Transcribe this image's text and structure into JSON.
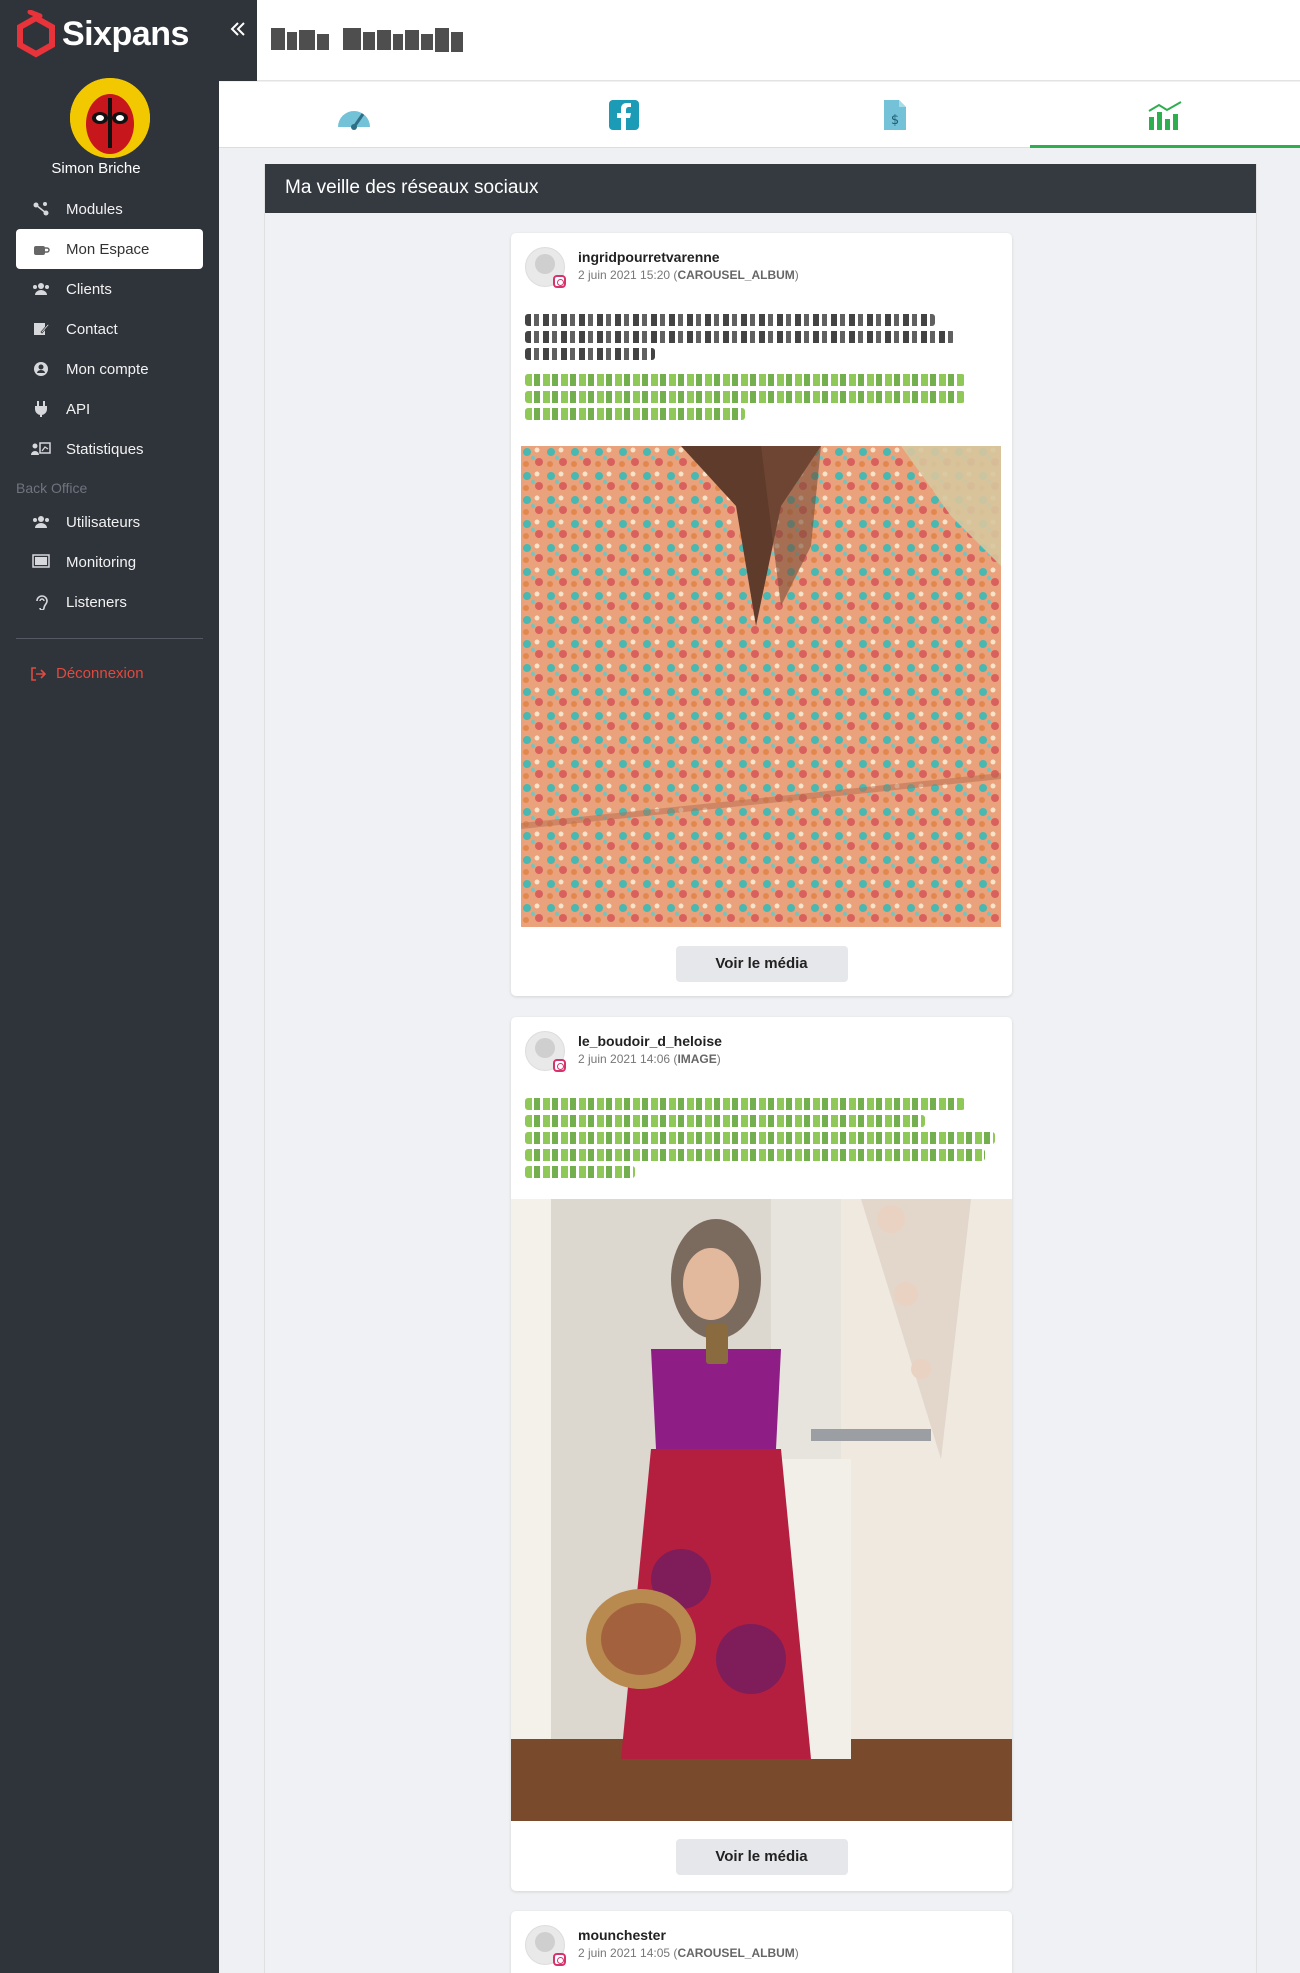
{
  "app": {
    "name": "Sixpans"
  },
  "sidebar": {
    "user_name": "Simon Briche",
    "items": [
      {
        "label": "Modules",
        "icon": "modules-icon"
      },
      {
        "label": "Mon Espace",
        "icon": "coffee-icon",
        "active": true
      },
      {
        "label": "Clients",
        "icon": "users-icon"
      },
      {
        "label": "Contact",
        "icon": "edit-icon"
      },
      {
        "label": "Mon compte",
        "icon": "user-circle-icon"
      },
      {
        "label": "API",
        "icon": "plug-icon"
      },
      {
        "label": "Statistiques",
        "icon": "chart-board-icon"
      }
    ],
    "back_office_label": "Back Office",
    "back_office_items": [
      {
        "label": "Utilisateurs",
        "icon": "users-icon"
      },
      {
        "label": "Monitoring",
        "icon": "monitor-icon"
      },
      {
        "label": "Listeners",
        "icon": "ear-icon"
      }
    ],
    "logout_label": "Déconnexion"
  },
  "header": {
    "collapse_icon": "double-chevron-left-icon"
  },
  "tabs": [
    {
      "icon": "dashboard-gauge-icon"
    },
    {
      "icon": "facebook-icon"
    },
    {
      "icon": "invoice-dollar-icon"
    },
    {
      "icon": "bar-chart-icon",
      "active": true
    }
  ],
  "panel": {
    "title": "Ma veille des réseaux sociaux",
    "posts": [
      {
        "username": "ingridpourretvarenne",
        "date": "2 juin 2021 15:20",
        "type": "CAROUSEL_ALBUM",
        "button": "Voir le média"
      },
      {
        "username": "le_boudoir_d_heloise",
        "date": "2 juin 2021 14:06",
        "type": "IMAGE",
        "button": "Voir le média"
      },
      {
        "username": "mounchester",
        "date": "2 juin 2021 14:05",
        "type": "CAROUSEL_ALBUM"
      }
    ]
  },
  "colors": {
    "sidebar_bg": "#2f333a",
    "accent_green": "#2eae4f",
    "logout_red": "#e04a3f",
    "instagram_pink": "#d6336c"
  }
}
